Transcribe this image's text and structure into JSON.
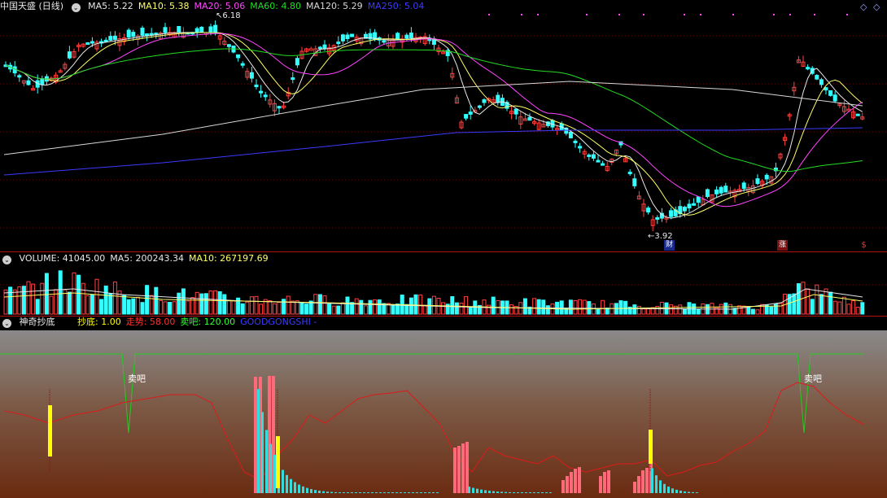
{
  "main": {
    "title": "中国天盛 (日线)",
    "ma_labels": [
      {
        "text": "MA5: 5.22",
        "color": "#e8e8e8"
      },
      {
        "text": "MA10: 5.38",
        "color": "#ffff66"
      },
      {
        "text": "MA20: 5.06",
        "color": "#ff44ff"
      },
      {
        "text": "MA60: 4.80",
        "color": "#22dd22"
      },
      {
        "text": "MA120: 5.29",
        "color": "#d8d8d8"
      },
      {
        "text": "MA250: 5.04",
        "color": "#3b3bff"
      }
    ],
    "high_label": "6.18",
    "low_label": "3.92",
    "event_badges": [
      "财",
      "涨",
      "$"
    ]
  },
  "volume": {
    "labels": [
      {
        "text": "VOLUME: 41045.00",
        "color": "#e8e8e8"
      },
      {
        "text": "MA5: 200243.34",
        "color": "#e8e8e8"
      },
      {
        "text": "MA10: 267197.69",
        "color": "#ffff66"
      }
    ]
  },
  "indicator": {
    "title": "神奇抄底",
    "labels": [
      {
        "text": "抄底: 1.00",
        "color": "#ffff00"
      },
      {
        "text": "走势: 58.00",
        "color": "#ff3030"
      },
      {
        "text": "卖吧: 120.00",
        "color": "#33ff33"
      },
      {
        "text": "GOODGONGSHI -",
        "color": "#3b3bff"
      }
    ],
    "sell_label": "卖吧"
  },
  "nav_icons": [
    "diamond-left-icon",
    "diamond-right-icon"
  ]
}
